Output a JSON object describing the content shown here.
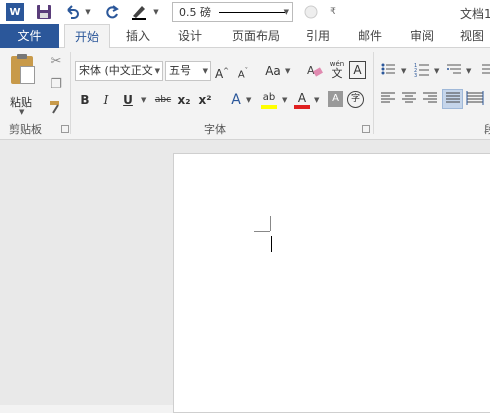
{
  "qat": {
    "app_icon_letter": "W",
    "line_weight": "0.5 磅",
    "doc_title": "文档1"
  },
  "tabs": [
    "文件",
    "开始",
    "插入",
    "设计",
    "页面布局",
    "引用",
    "邮件",
    "审阅",
    "视图"
  ],
  "clipboard": {
    "paste_label": "粘贴",
    "group_label": "剪贴板"
  },
  "font": {
    "font_name": "宋体 (中文正文",
    "font_size": "五号",
    "change_case": "Aa",
    "group_label": "字体",
    "phonetic_guide_top": "wén",
    "phonetic_guide_char": "文",
    "bold": "B",
    "italic": "I",
    "underline": "U",
    "strikethrough": "abc",
    "subscript": "x₂",
    "superscript": "x²",
    "text_effects": "A",
    "highlight": "ab",
    "font_color": "A",
    "char_shading": "A",
    "enclose_char": "字",
    "char_border": "A"
  },
  "paragraph": {
    "group_label": "段"
  },
  "colors": {
    "brand": "#2b579a",
    "highlight": "#ffff00",
    "font_color": "#e02020"
  }
}
